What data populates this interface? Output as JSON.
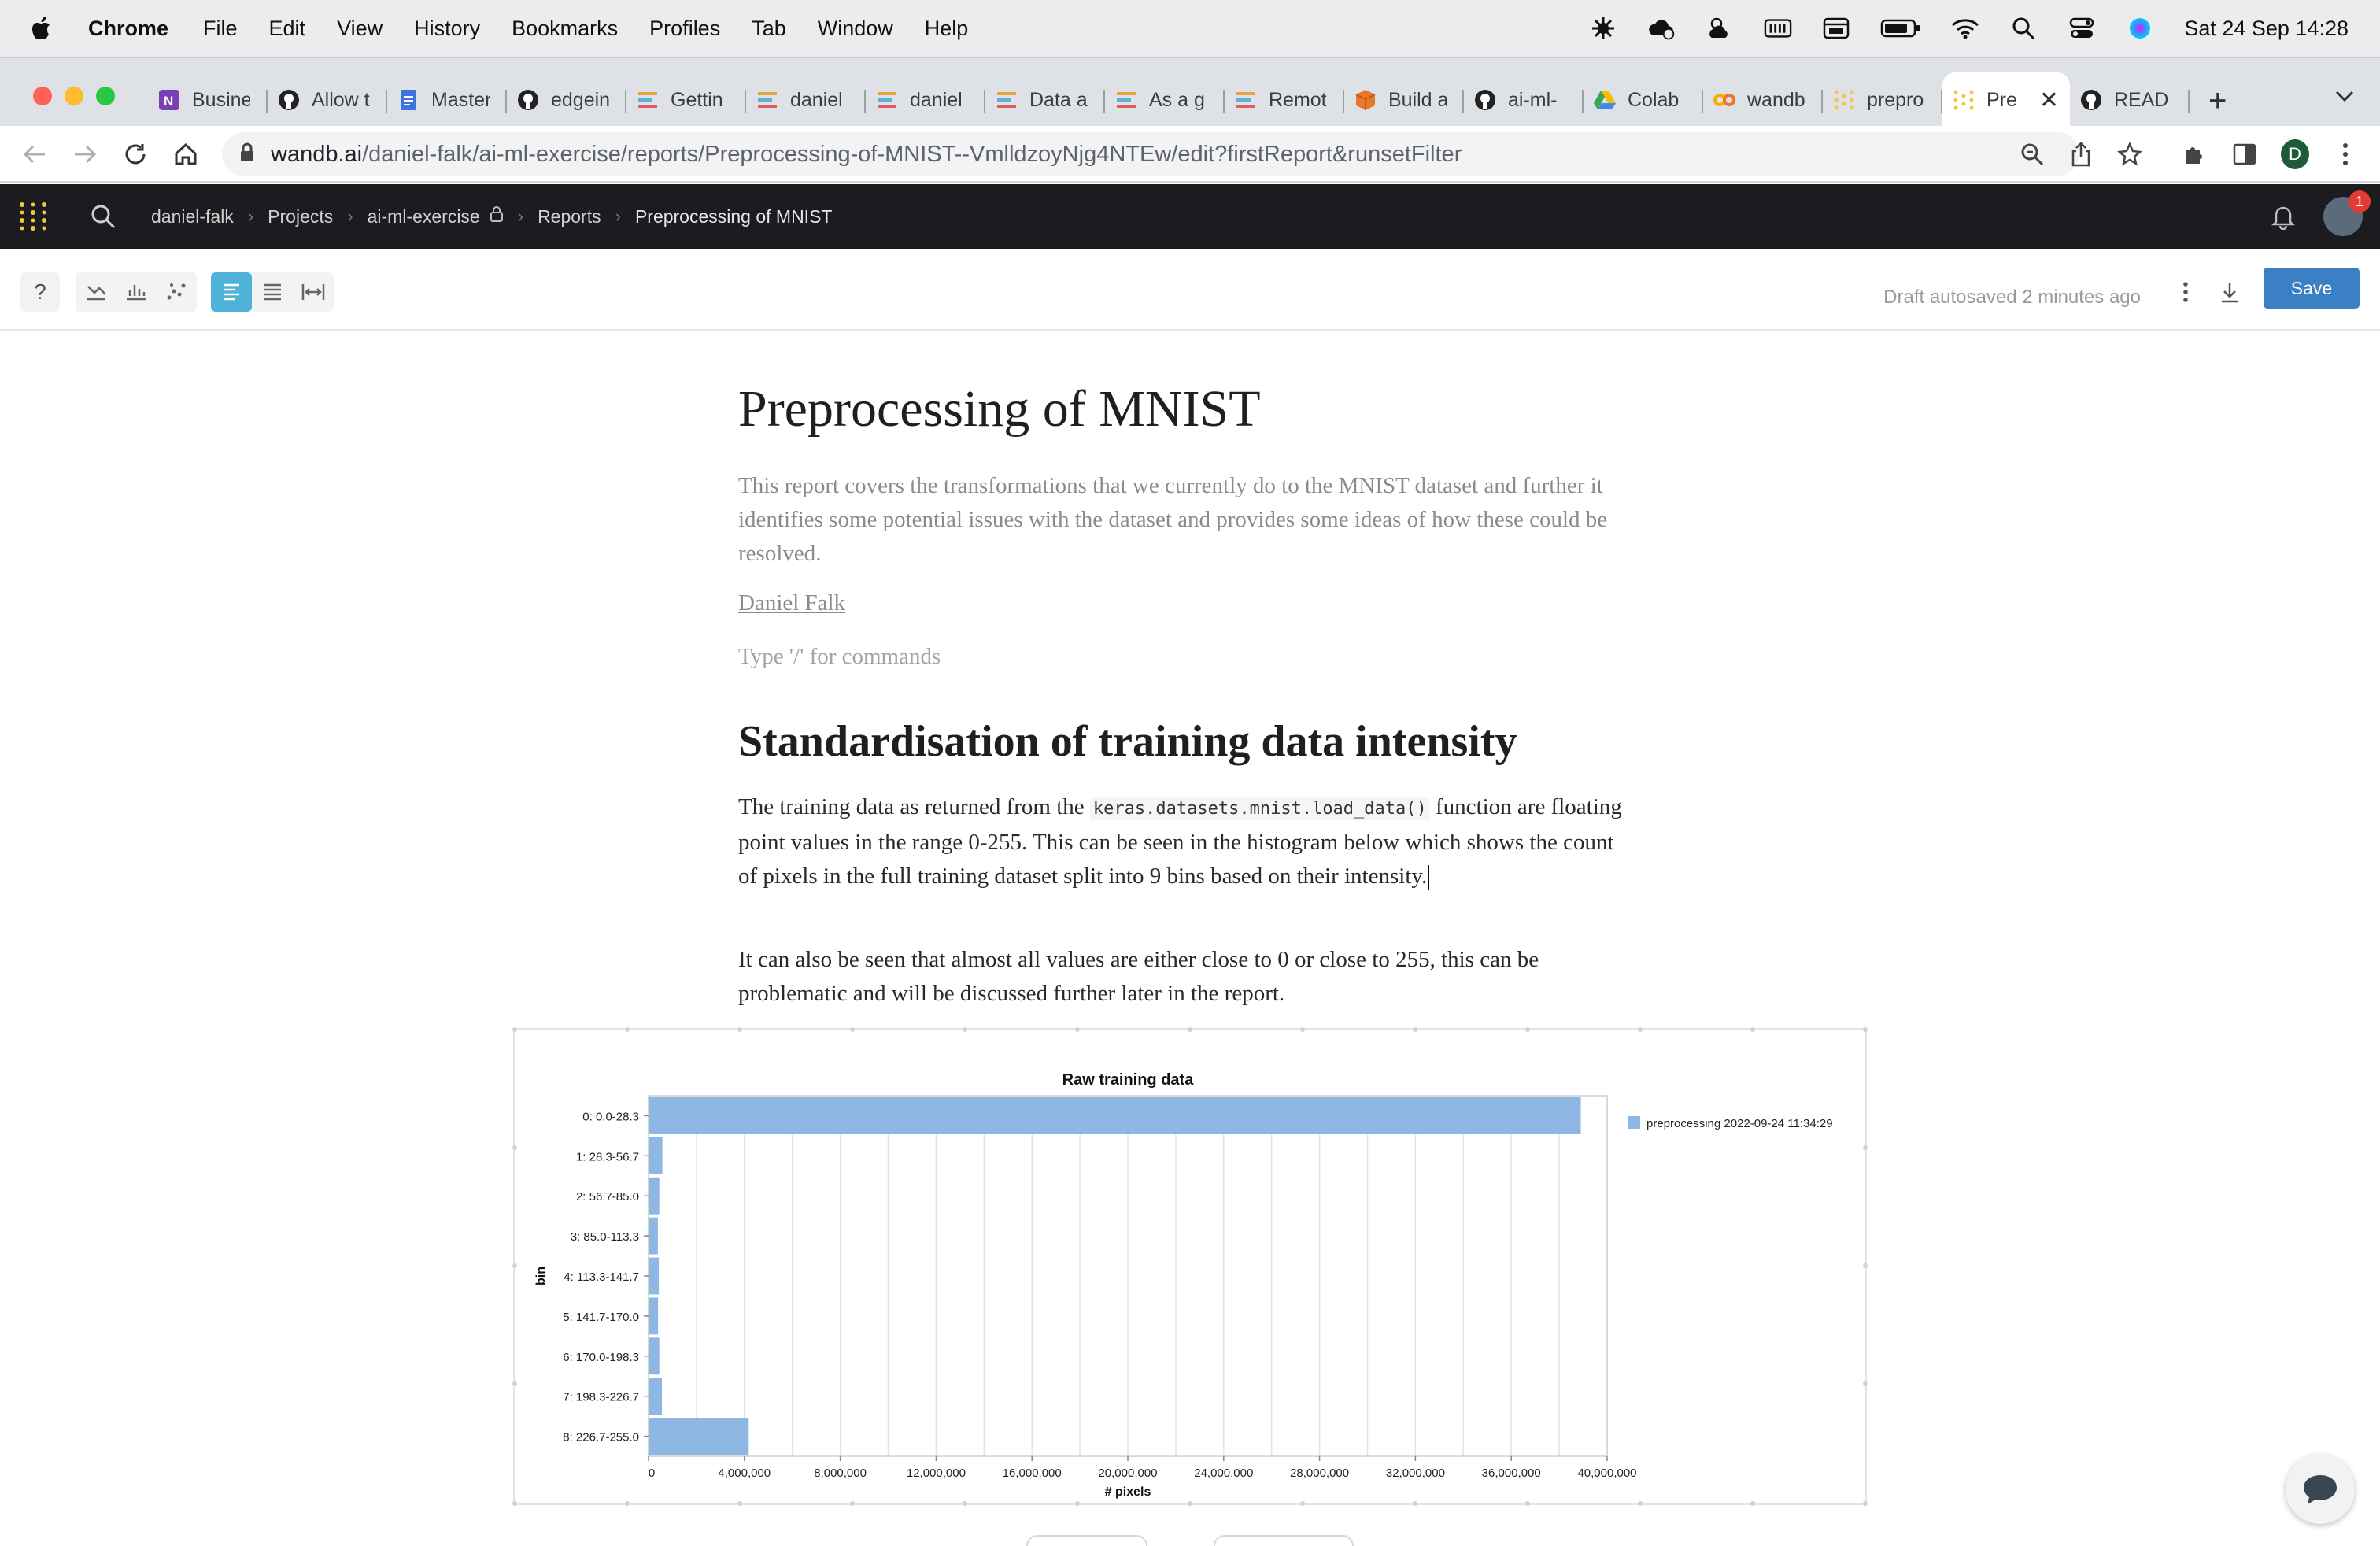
{
  "menubar": {
    "app_name": "Chrome",
    "items": [
      "File",
      "Edit",
      "View",
      "History",
      "Bookmarks",
      "Profiles",
      "Tab",
      "Window",
      "Help"
    ],
    "clock": "Sat 24 Sep  14:28"
  },
  "browser": {
    "tabs": [
      {
        "label": "Busine",
        "icon": "onenote-icon",
        "color": "#7b3fb5"
      },
      {
        "label": "Allow t",
        "icon": "github-icon",
        "color": "#222222"
      },
      {
        "label": "Master",
        "icon": "docs-icon",
        "color": "#3b73e0"
      },
      {
        "label": "edgein",
        "icon": "github-icon",
        "color": "#222222"
      },
      {
        "label": "Gettin",
        "icon": "wandb-icon",
        "color": "#e8a33d"
      },
      {
        "label": "daniel",
        "icon": "wandb-icon",
        "color": "#e8a33d"
      },
      {
        "label": "daniel",
        "icon": "wandb-icon",
        "color": "#e8a33d"
      },
      {
        "label": "Data a",
        "icon": "wandb-icon",
        "color": "#e8a33d"
      },
      {
        "label": "As a g",
        "icon": "wandb-icon",
        "color": "#e8a33d"
      },
      {
        "label": "Remot",
        "icon": "wandb-icon",
        "color": "#e8a33d"
      },
      {
        "label": "Build a",
        "icon": "package-icon",
        "color": "#e8772a"
      },
      {
        "label": "ai-ml-",
        "icon": "github-icon",
        "color": "#222222"
      },
      {
        "label": "Colab",
        "icon": "drive-icon",
        "color": "#34a853"
      },
      {
        "label": "wandb",
        "icon": "colab-icon",
        "color": "#f9ab00"
      },
      {
        "label": "prepro",
        "icon": "wandb-dots-icon",
        "color": "#f5c542"
      },
      {
        "label": "Pre",
        "icon": "wandb-dots-icon",
        "color": "#f5c542",
        "active": true
      },
      {
        "label": "READ",
        "icon": "github-icon",
        "color": "#222222"
      }
    ],
    "url_host": "wandb.ai",
    "url_path": "/daniel-falk/ai-ml-exercise/reports/Preprocessing-of-MNIST--VmlldzoyNjg4NTEw/edit?firstReport&runsetFilter",
    "profile_initial": "D"
  },
  "wb_header": {
    "breadcrumbs": [
      "daniel-falk",
      "Projects",
      "ai-ml-exercise",
      "Reports",
      "Preprocessing of MNIST"
    ],
    "notification_count": "1"
  },
  "report_toolbar": {
    "autosave_text": "Draft autosaved 2 minutes ago",
    "save_label": "Save",
    "help_label": "?"
  },
  "report": {
    "title": "Preprocessing of MNIST",
    "description": "This report covers the transformations that we currently do to the MNIST dataset and further it identifies some potential issues with the dataset and provides some ideas of how these could be resolved.",
    "author": "Daniel Falk",
    "command_hint": "Type '/' for commands",
    "section_heading": "Standardisation of training data intensity",
    "para1_before": "The training data as returned from the ",
    "para1_code": "keras.datasets.mnist.load_data()",
    "para1_after": " function are floating point values in the range 0-255. This can be seen in the histogram below which shows the count of pixels in the full training dataset split into 9 bins based on their intensity.",
    "para2": "It can also be seen that almost all values are either close to 0 or close to 255, this can be problematic and will be discussed further later in the report."
  },
  "chart_data": {
    "type": "bar",
    "orientation": "horizontal",
    "title": "Raw training data",
    "xlabel": "# pixels",
    "ylabel": "bin",
    "categories": [
      "0: 0.0-28.3",
      "1: 28.3-56.7",
      "2: 56.7-85.0",
      "3: 85.0-113.3",
      "4: 113.3-141.7",
      "5: 141.7-170.0",
      "6: 170.0-198.3",
      "7: 198.3-226.7",
      "8: 226.7-255.0"
    ],
    "series": [
      {
        "name": "preprocessing 2022-09-24 11:34:29",
        "values": [
          38900000,
          580000,
          450000,
          390000,
          430000,
          400000,
          450000,
          560000,
          4180000
        ],
        "color": "#8fb7e4"
      }
    ],
    "xlim": [
      0,
      40000000
    ],
    "xticks": [
      0,
      4000000,
      8000000,
      12000000,
      16000000,
      20000000,
      24000000,
      28000000,
      32000000,
      36000000,
      40000000
    ],
    "xtick_labels": [
      "0",
      "4,000,000",
      "8,000,000",
      "12,000,000",
      "16,000,000",
      "20,000,000",
      "24,000,000",
      "28,000,000",
      "32,000,000",
      "36,000,000",
      "40,000,000"
    ],
    "grid": true,
    "legend": "top-right"
  }
}
